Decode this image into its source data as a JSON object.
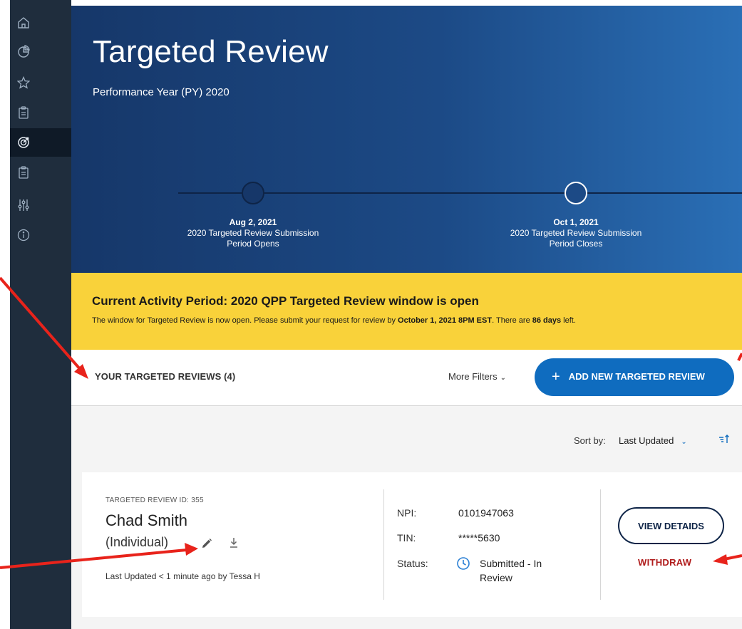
{
  "colors": {
    "sidebar_bg": "#1f2d3d",
    "header_gradient_start": "#163769",
    "header_gradient_end": "#2a6fb6",
    "alert_bg": "#f9d23a",
    "primary_button": "#0f6cbf",
    "withdraw_red": "#b01c1c",
    "annotation_arrow": "#e8231b"
  },
  "sidebar": {
    "items": [
      {
        "icon": "home-icon"
      },
      {
        "icon": "pie-chart-icon"
      },
      {
        "icon": "star-icon"
      },
      {
        "icon": "clipboard-icon"
      },
      {
        "icon": "targeted-review-icon",
        "active": true
      },
      {
        "icon": "clipboard-list-icon"
      },
      {
        "icon": "sliders-icon"
      },
      {
        "icon": "info-icon"
      }
    ]
  },
  "header": {
    "title": "Targeted Review",
    "subtitle": "Performance Year (PY) 2020",
    "milestones": [
      {
        "date": "Aug 2, 2021",
        "label_line1": "2020 Targeted Review Submission",
        "label_line2": "Period Opens"
      },
      {
        "date": "Oct 1, 2021",
        "label_line1": "2020 Targeted Review Submission",
        "label_line2": "Period Closes"
      }
    ]
  },
  "alert": {
    "title": "Current Activity Period: 2020 QPP Targeted Review window is open",
    "body_part1": "The window for Targeted Review is now open. Please submit your request for review by ",
    "body_deadline": "October 1, 2021 8PM EST",
    "body_part2": ". There are ",
    "body_days": "86 days",
    "body_part3": " left."
  },
  "toolbar": {
    "heading": "YOUR TARGETED REVIEWS (4)",
    "more_filters": "More Filters",
    "add_button": "ADD NEW TARGETED REVIEW"
  },
  "sort": {
    "label": "Sort by:",
    "selected": "Last Updated"
  },
  "review_card": {
    "id_label": "TARGETED REVIEW ID: 355",
    "name": "Chad Smith",
    "type": "(Individual)",
    "last_updated": "Last Updated < 1 minute ago by Tessa H",
    "npi_label": "NPI:",
    "npi_value": "0101947063",
    "tin_label": "TIN:",
    "tin_value": "*****5630",
    "status_label": "Status:",
    "status_value": "Submitted - In Review",
    "view_details": "VIEW DETAIDS",
    "withdraw": "WITHDRAW"
  }
}
